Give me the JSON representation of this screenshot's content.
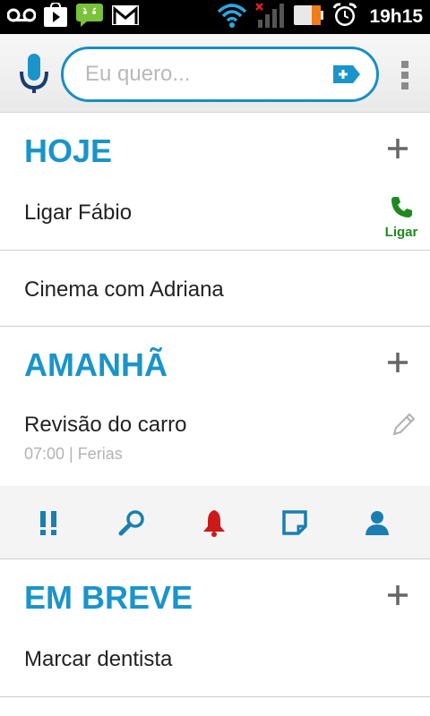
{
  "status_bar": {
    "time": "19h15",
    "left_icons": [
      "voicemail-icon",
      "play-store-icon",
      "android-chat-icon",
      "gmail-icon"
    ],
    "right_icons": [
      "wifi-icon",
      "signal-off-icon",
      "battery-icon",
      "alarm-icon"
    ]
  },
  "topbar": {
    "search_placeholder": "Eu quero...",
    "icons": [
      "microphone-icon",
      "add-tag-icon",
      "overflow-menu-icon"
    ]
  },
  "sections": [
    {
      "title": "HOJE",
      "tasks": [
        {
          "title": "Ligar Fábio",
          "action_label": "Ligar"
        },
        {
          "title": "Cinema com Adriana"
        }
      ]
    },
    {
      "title": "AMANHÃ",
      "tasks": [
        {
          "title": "Revisão do carro",
          "subtitle": "07:00 | Ferias"
        }
      ]
    },
    {
      "title": "EM BREVE",
      "tasks": [
        {
          "title": "Marcar dentista"
        }
      ]
    }
  ],
  "task_toolbar": {
    "tools": [
      "priority-icon",
      "search-icon",
      "bell-icon",
      "note-icon",
      "contact-icon"
    ],
    "colors": {
      "blue": "#1a7fb0",
      "red": "#cc1a1a"
    }
  },
  "colors": {
    "accent": "#1a94c9",
    "call_green": "#1e8a1e"
  }
}
